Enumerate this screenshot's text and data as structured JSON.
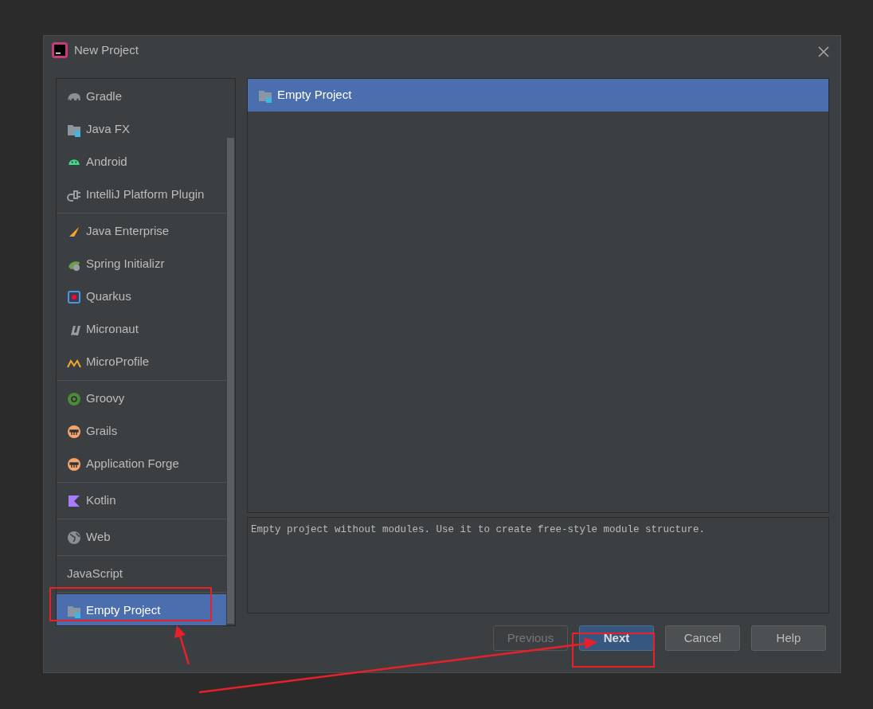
{
  "window": {
    "title": "New Project"
  },
  "sidebar": {
    "groups": [
      {
        "items": [
          {
            "label": "Gradle",
            "kind": "gradle",
            "selected": false
          },
          {
            "label": "Java FX",
            "kind": "folder",
            "selected": false
          },
          {
            "label": "Android",
            "kind": "android",
            "selected": false
          },
          {
            "label": "IntelliJ Platform Plugin",
            "kind": "plugin",
            "selected": false
          }
        ]
      },
      {
        "items": [
          {
            "label": "Java Enterprise",
            "kind": "sail",
            "selected": false
          },
          {
            "label": "Spring Initializr",
            "kind": "leaf",
            "selected": false
          },
          {
            "label": "Quarkus",
            "kind": "quarkus",
            "selected": false
          },
          {
            "label": "Micronaut",
            "kind": "mu",
            "selected": false
          },
          {
            "label": "MicroProfile",
            "kind": "wave",
            "selected": false
          }
        ]
      },
      {
        "items": [
          {
            "label": "Groovy",
            "kind": "groovy",
            "selected": false
          },
          {
            "label": "Grails",
            "kind": "grails",
            "selected": false
          },
          {
            "label": "Application Forge",
            "kind": "grails",
            "selected": false
          }
        ]
      },
      {
        "items": [
          {
            "label": "Kotlin",
            "kind": "kotlin",
            "selected": false
          }
        ]
      },
      {
        "items": [
          {
            "label": "Web",
            "kind": "globe",
            "selected": false
          }
        ]
      },
      {
        "items": [
          {
            "label": "JavaScript",
            "kind": "text",
            "selected": false
          }
        ]
      },
      {
        "items": [
          {
            "label": "Empty Project",
            "kind": "folder",
            "selected": true
          }
        ]
      }
    ]
  },
  "templates": {
    "items": [
      {
        "label": "Empty Project",
        "kind": "folder",
        "selected": true
      }
    ]
  },
  "description": "Empty project without modules. Use it to create free-style module structure.",
  "buttons": [
    {
      "label": "Previous",
      "kind": "default",
      "disabled": true
    },
    {
      "label": "Next",
      "kind": "primary",
      "disabled": false
    },
    {
      "label": "Cancel",
      "kind": "default",
      "disabled": false
    },
    {
      "label": "Help",
      "kind": "default",
      "disabled": false
    }
  ]
}
